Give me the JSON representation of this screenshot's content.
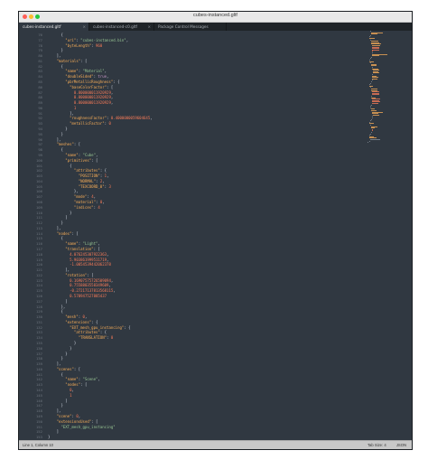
{
  "window": {
    "title": "cubes-instanced.gltf"
  },
  "tabs": [
    {
      "label": "cubes-instanced.gltf",
      "active": true
    },
    {
      "label": "cubes-instanced-c0.gltf",
      "active": false
    },
    {
      "label": "Package Control Messages",
      "active": false
    }
  ],
  "editor": {
    "lines": [
      {
        "n": "76",
        "t": "      {"
      },
      {
        "n": "77",
        "t": "        \"uri\": \"cubes-instanced.bin\","
      },
      {
        "n": "78",
        "t": "        \"byteLength\": 960"
      },
      {
        "n": "79",
        "t": "      }"
      },
      {
        "n": "80",
        "t": "    ],"
      },
      {
        "n": "81",
        "t": "    \"materials\": ["
      },
      {
        "n": "82",
        "t": "      {"
      },
      {
        "n": "83",
        "t": "        \"name\": \"Material\","
      },
      {
        "n": "84",
        "t": "        \"doubleSided\": true,"
      },
      {
        "n": "85",
        "t": "        \"pbrMetallicRoughness\": {"
      },
      {
        "n": "86",
        "t": "          \"baseColorFactor\": ["
      },
      {
        "n": "87",
        "t": "            0.800000011920929,"
      },
      {
        "n": "88",
        "t": "            0.800000011920929,"
      },
      {
        "n": "89",
        "t": "            0.800000011920929,"
      },
      {
        "n": "90",
        "t": "            1"
      },
      {
        "n": "91",
        "t": "          ],"
      },
      {
        "n": "92",
        "t": "          \"roughnessFactor\": 0.4000000059604645,"
      },
      {
        "n": "93",
        "t": "          \"metallicFactor\": 0"
      },
      {
        "n": "94",
        "t": "        }"
      },
      {
        "n": "95",
        "t": "      }"
      },
      {
        "n": "96",
        "t": "    ],"
      },
      {
        "n": "97",
        "t": "    \"meshes\": ["
      },
      {
        "n": "98",
        "t": "      {"
      },
      {
        "n": "99",
        "t": "        \"name\": \"Cube\","
      },
      {
        "n": "100",
        "t": "        \"primitives\": ["
      },
      {
        "n": "101",
        "t": "          {"
      },
      {
        "n": "102",
        "t": "            \"attributes\": {"
      },
      {
        "n": "103",
        "t": "              \"POSITION\": 1,"
      },
      {
        "n": "104",
        "t": "              \"NORMAL\": 2,"
      },
      {
        "n": "105",
        "t": "              \"TEXCOORD_0\": 3"
      },
      {
        "n": "106",
        "t": "            },"
      },
      {
        "n": "107",
        "t": "            \"mode\": 4,"
      },
      {
        "n": "108",
        "t": "            \"material\": 0,"
      },
      {
        "n": "109",
        "t": "            \"indices\": 4"
      },
      {
        "n": "110",
        "t": "          }"
      },
      {
        "n": "111",
        "t": "        ]"
      },
      {
        "n": "112",
        "t": "      }"
      },
      {
        "n": "113",
        "t": "    ],"
      },
      {
        "n": "114",
        "t": "    \"nodes\": ["
      },
      {
        "n": "115",
        "t": "      {"
      },
      {
        "n": "116",
        "t": "        \"name\": \"Light\","
      },
      {
        "n": "117",
        "t": "        \"translation\": ["
      },
      {
        "n": "118",
        "t": "          4.076245307922363,"
      },
      {
        "n": "119",
        "t": "          5.903861999511719,"
      },
      {
        "n": "120",
        "t": "          -1.0054539442062378"
      },
      {
        "n": "121",
        "t": "        ],"
      },
      {
        "n": "122",
        "t": "        \"rotation\": ["
      },
      {
        "n": "123",
        "t": "          0.16907575726509094,"
      },
      {
        "n": "124",
        "t": "          0.7558803558349609,"
      },
      {
        "n": "125",
        "t": "          -0.27217137813568115,"
      },
      {
        "n": "126",
        "t": "          0.570947527885437"
      },
      {
        "n": "127",
        "t": "        ]"
      },
      {
        "n": "128",
        "t": "      },"
      },
      {
        "n": "129",
        "t": "      {"
      },
      {
        "n": "130",
        "t": "        \"mesh\": 0,"
      },
      {
        "n": "131",
        "t": "        \"extensions\": {"
      },
      {
        "n": "132",
        "t": "          \"EXT_mesh_gpu_instancing\": {"
      },
      {
        "n": "133",
        "t": "            \"attributes\": {"
      },
      {
        "n": "134",
        "t": "              \"TRANSLATION\": 0"
      },
      {
        "n": "135",
        "t": "            }"
      },
      {
        "n": "136",
        "t": "          }"
      },
      {
        "n": "137",
        "t": "        }"
      },
      {
        "n": "138",
        "t": "      }"
      },
      {
        "n": "139",
        "t": "    ],"
      },
      {
        "n": "140",
        "t": "    \"scenes\": ["
      },
      {
        "n": "141",
        "t": "      {"
      },
      {
        "n": "142",
        "t": "        \"name\": \"Scene\","
      },
      {
        "n": "143",
        "t": "        \"nodes\": ["
      },
      {
        "n": "144",
        "t": "          0,"
      },
      {
        "n": "145",
        "t": "          1"
      },
      {
        "n": "146",
        "t": "        ]"
      },
      {
        "n": "147",
        "t": "      }"
      },
      {
        "n": "148",
        "t": "    ],"
      },
      {
        "n": "149",
        "t": "    \"scene\": 0,"
      },
      {
        "n": "150",
        "t": "    \"extensionsUsed\": ["
      },
      {
        "n": "151",
        "t": "      \"EXT_mesh_gpu_instancing\""
      },
      {
        "n": "152",
        "t": "    ]"
      },
      {
        "n": "153",
        "t": "}"
      }
    ]
  },
  "colors": {
    "editor_bg": "#303841",
    "key": "#f9ae58",
    "string": "#99c794",
    "number": "#f97b58",
    "boolean": "#c695c6"
  },
  "statusbar": {
    "position": "Line 1, Column 10",
    "tab_size": "Tab Size: 4",
    "syntax": "JSON"
  }
}
